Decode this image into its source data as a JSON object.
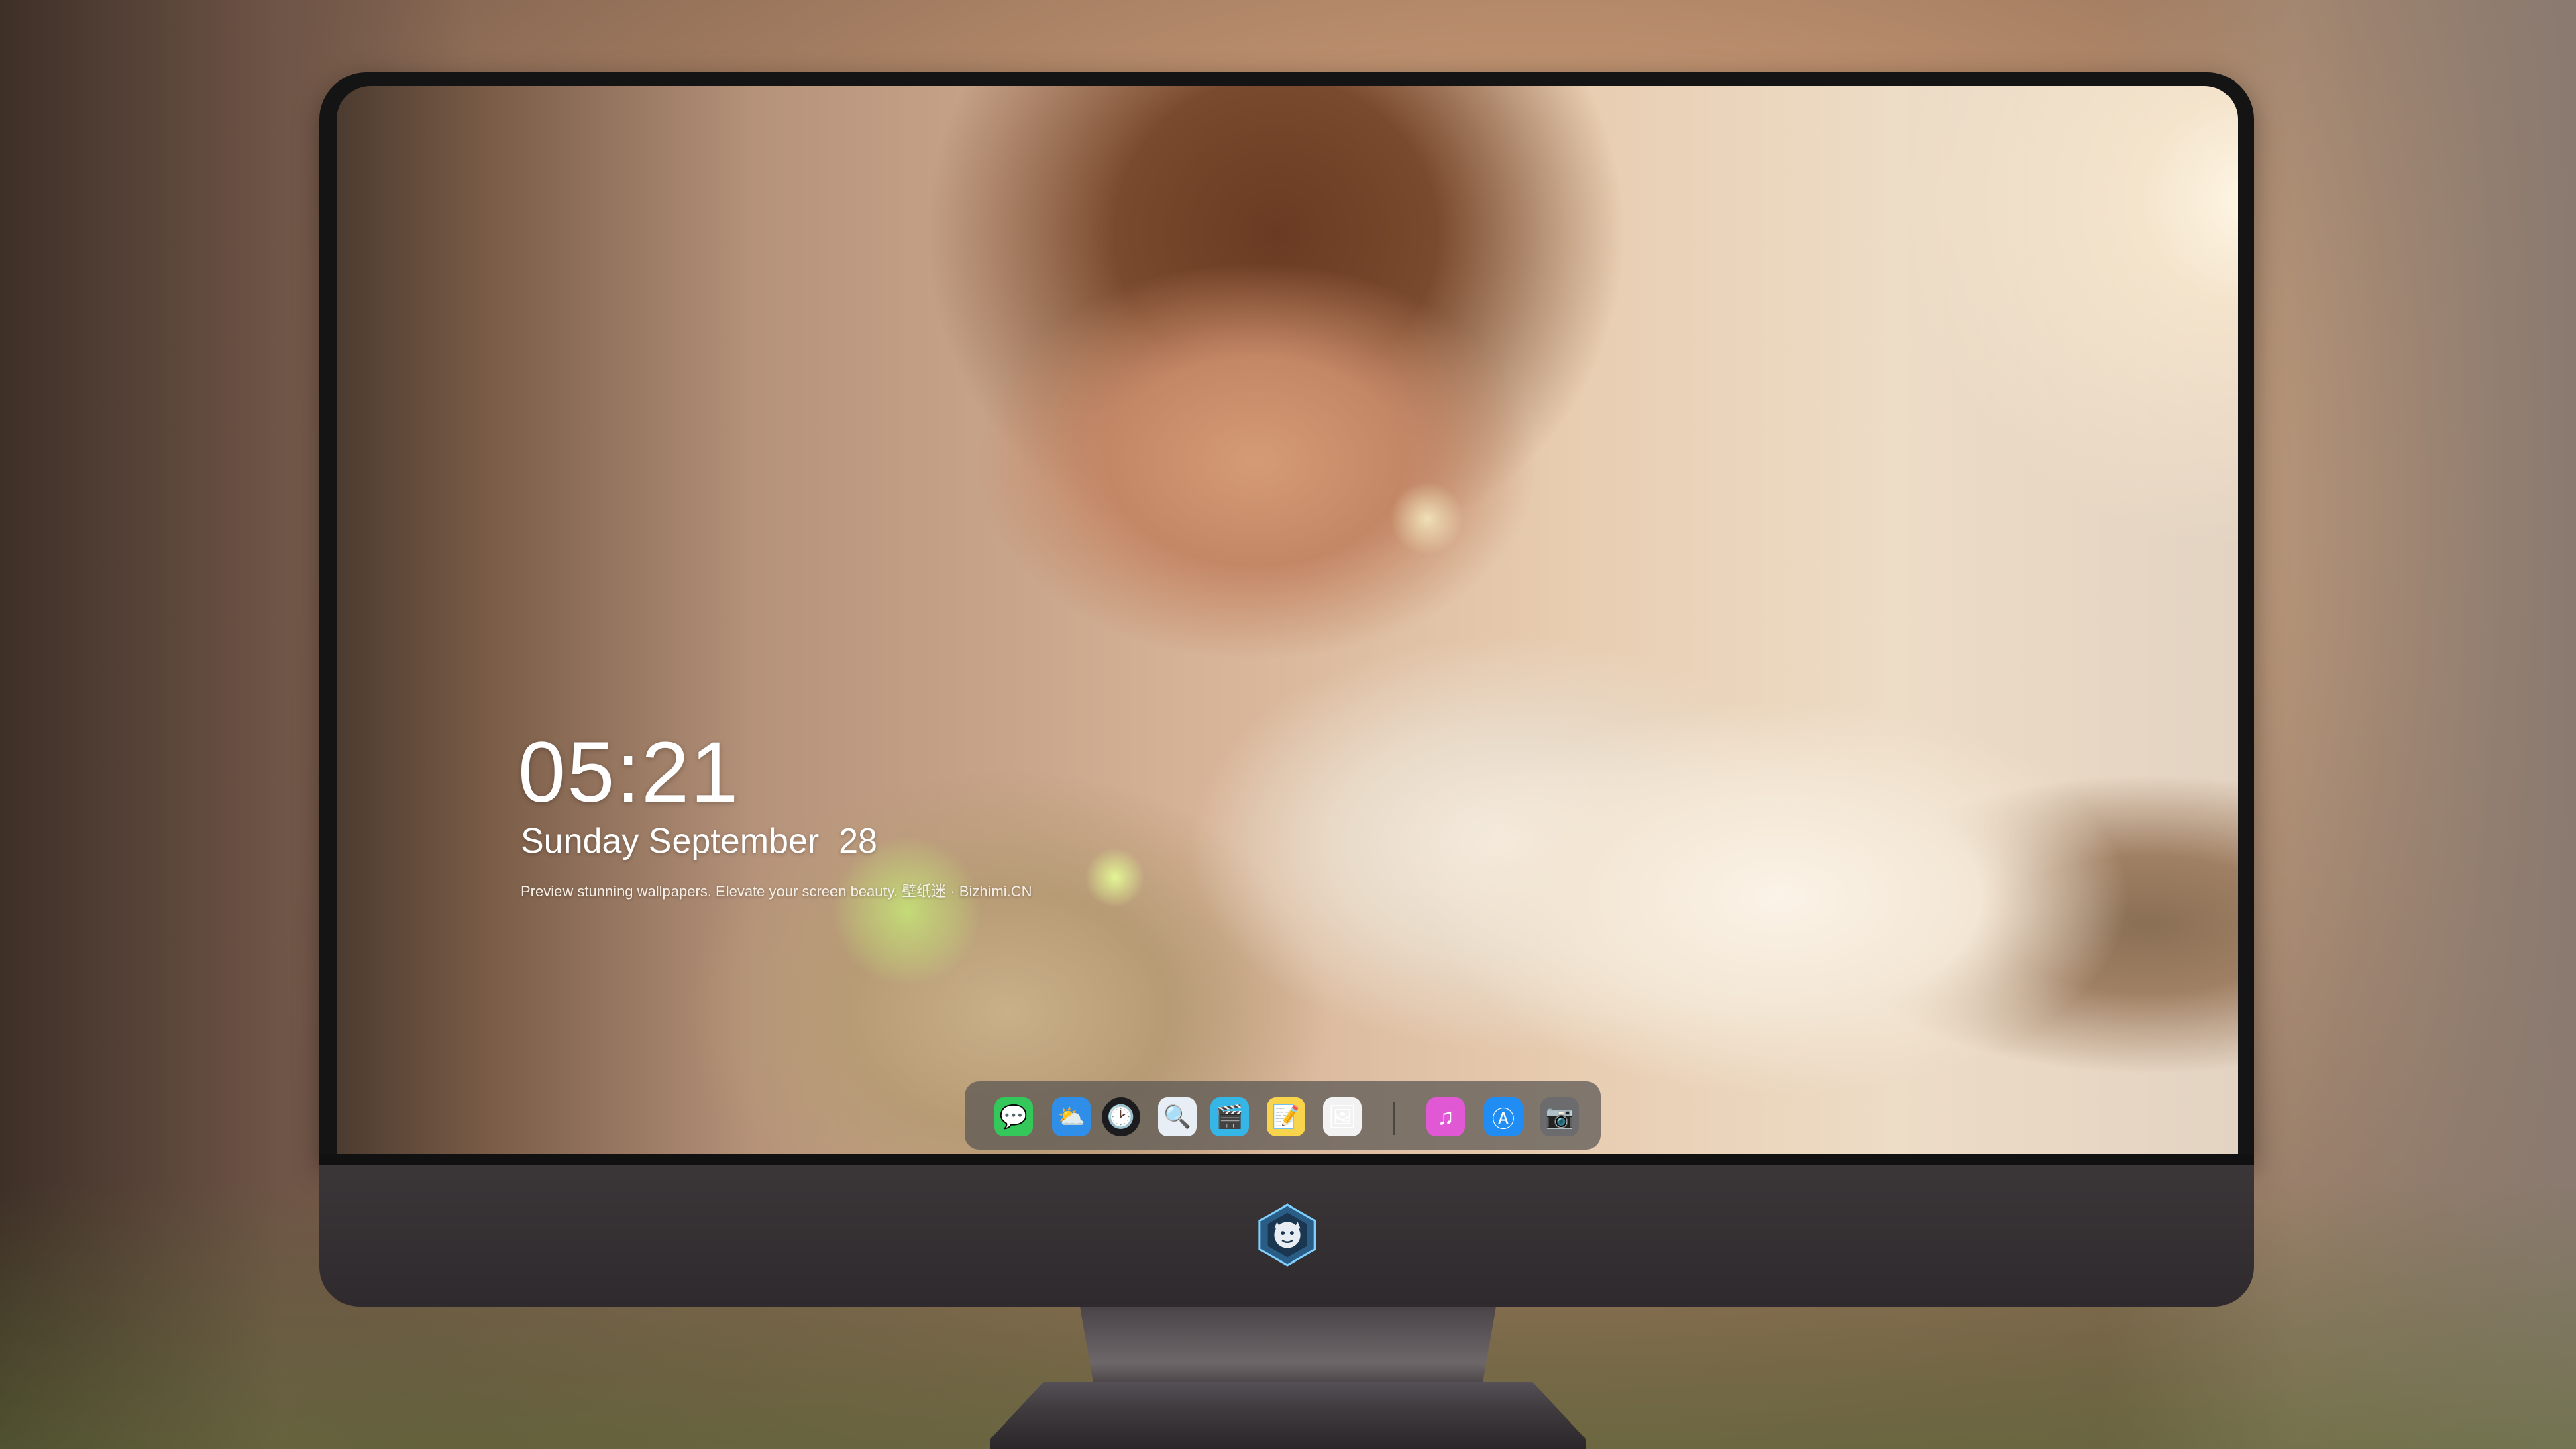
{
  "lock_screen": {
    "time": "05:21",
    "date": "Sunday September  28",
    "tagline": "Preview stunning wallpapers. Elevate your screen beauty. 壁纸迷 · Bizhimi.CN"
  },
  "dock": {
    "apps": [
      {
        "name": "Messages",
        "icon": "messages-icon",
        "glyph": "💬",
        "color": "#34c759"
      },
      {
        "name": "Weather",
        "icon": "weather-icon",
        "glyph": "⛅",
        "color": "#2f8fe8"
      },
      {
        "name": "Clock",
        "icon": "clock-icon",
        "glyph": "🕑",
        "color": "#1c1c1e"
      },
      {
        "name": "Preview",
        "icon": "preview-icon",
        "glyph": "🔍",
        "color": "#e8eef6"
      },
      {
        "name": "Clips",
        "icon": "clapperboard-icon",
        "glyph": "🎬",
        "color": "#36b6e6"
      },
      {
        "name": "Notes",
        "icon": "notes-icon",
        "glyph": "📝",
        "color": "#f7d44c"
      },
      {
        "name": "Photo Booth",
        "icon": "photo-grid-icon",
        "glyph": "🖼",
        "color": "#f2f2f2"
      },
      {
        "name": "iTunes",
        "icon": "music-note-icon",
        "glyph": "♫",
        "color": "#e058d4"
      },
      {
        "name": "App Store",
        "icon": "app-store-icon",
        "glyph": "Ⓐ",
        "color": "#1f8df4"
      },
      {
        "name": "Camera",
        "icon": "camera-icon",
        "glyph": "📷",
        "color": "#6c6c6e"
      }
    ]
  },
  "monitor": {
    "logo": "dragon-crest-logo"
  }
}
